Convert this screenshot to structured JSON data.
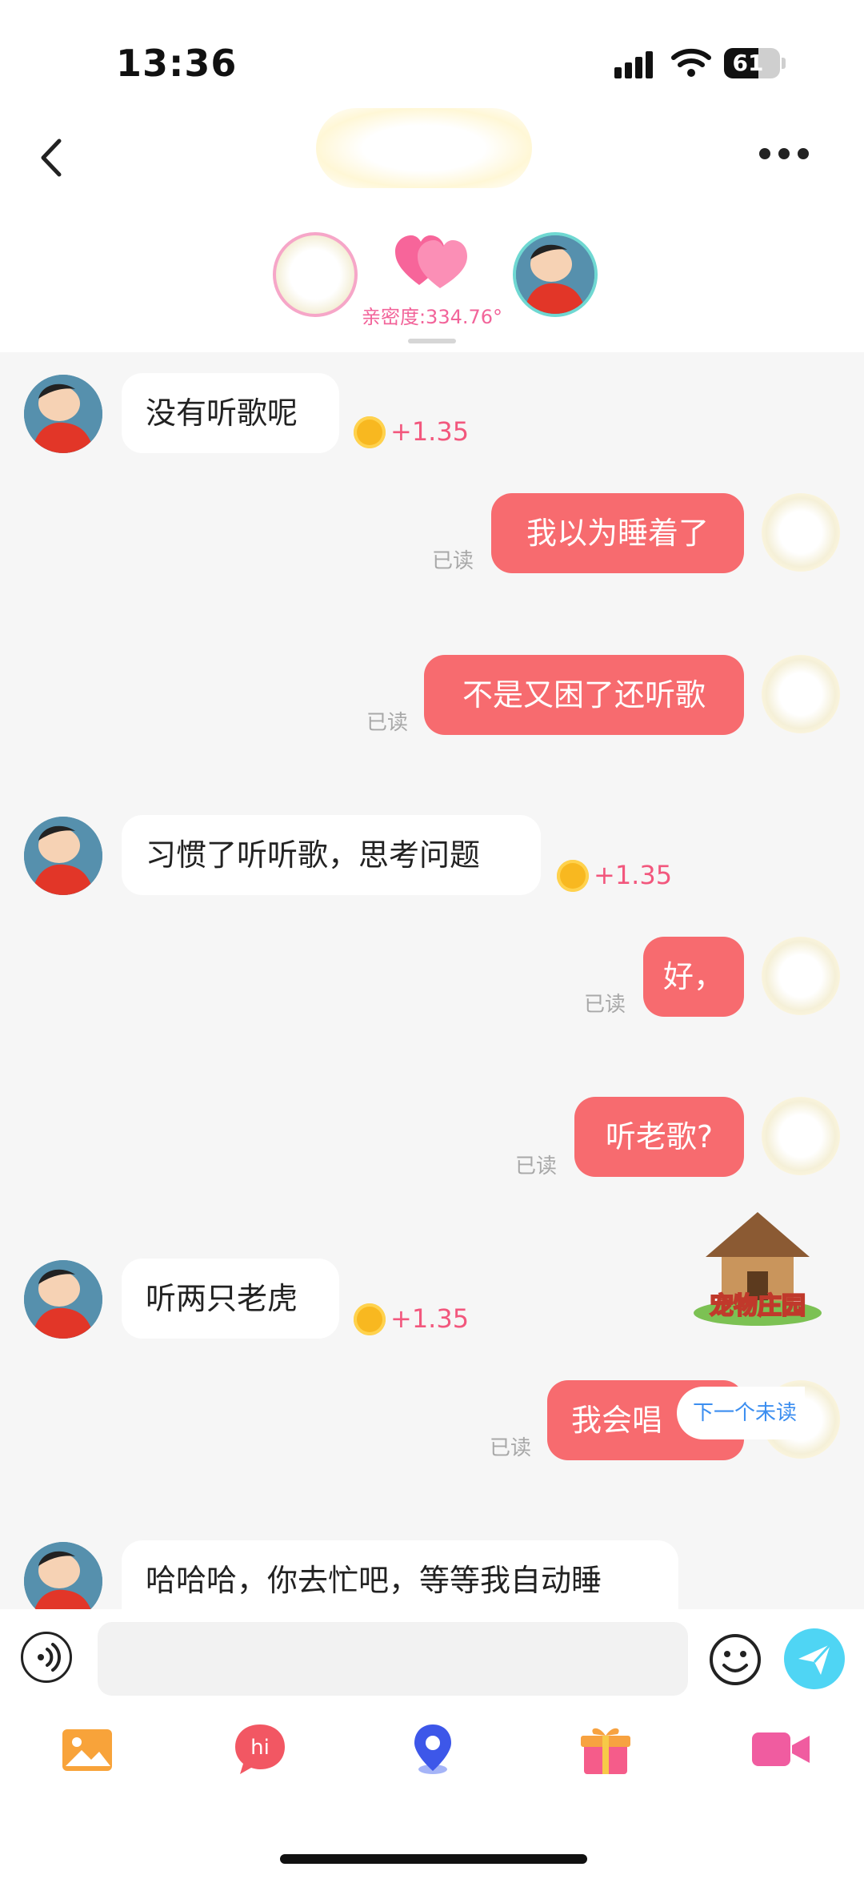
{
  "status_bar": {
    "time": "13:36",
    "battery_level": "61",
    "battery_fraction": 0.61
  },
  "header": {
    "intimacy_label": "亲密度:334.76°"
  },
  "messages": [
    {
      "side": "in",
      "text": "没有听歌呢",
      "reward": "+1.35"
    },
    {
      "side": "out",
      "text": "我以为睡着了",
      "read_label": "已读"
    },
    {
      "side": "out",
      "text": "不是又困了还听歌",
      "read_label": "已读"
    },
    {
      "side": "in",
      "text": "习惯了听听歌，思考问题",
      "reward": "+1.35"
    },
    {
      "side": "out",
      "text": "好，",
      "read_label": "已读"
    },
    {
      "side": "out",
      "text": "听老歌?",
      "read_label": "已读"
    },
    {
      "side": "in",
      "text": "听两只老虎",
      "reward": "+1.35"
    },
    {
      "side": "out",
      "text": "我会唱",
      "read_label": "已读"
    },
    {
      "side": "in",
      "text": "哈哈哈，你去忙吧，等等我自动睡"
    }
  ],
  "next_unread_label": "下一个未读",
  "pet_banner_label": "宠物庄园",
  "input": {
    "placeholder": ""
  },
  "colors": {
    "outgoing_bubble": "#f76b6f",
    "incoming_bubble": "#ffffff",
    "reward_text": "#f2577d",
    "send_button": "#4fd5f4",
    "intimacy_text": "#f2649a"
  },
  "icons": [
    "back-arrow-icon",
    "more-dots-icon",
    "hearts-icon",
    "coin-icon",
    "voice-icon",
    "emoji-icon",
    "send-icon",
    "image-icon",
    "hi-greeting-icon",
    "location-pin-icon",
    "gift-icon",
    "video-call-icon"
  ]
}
